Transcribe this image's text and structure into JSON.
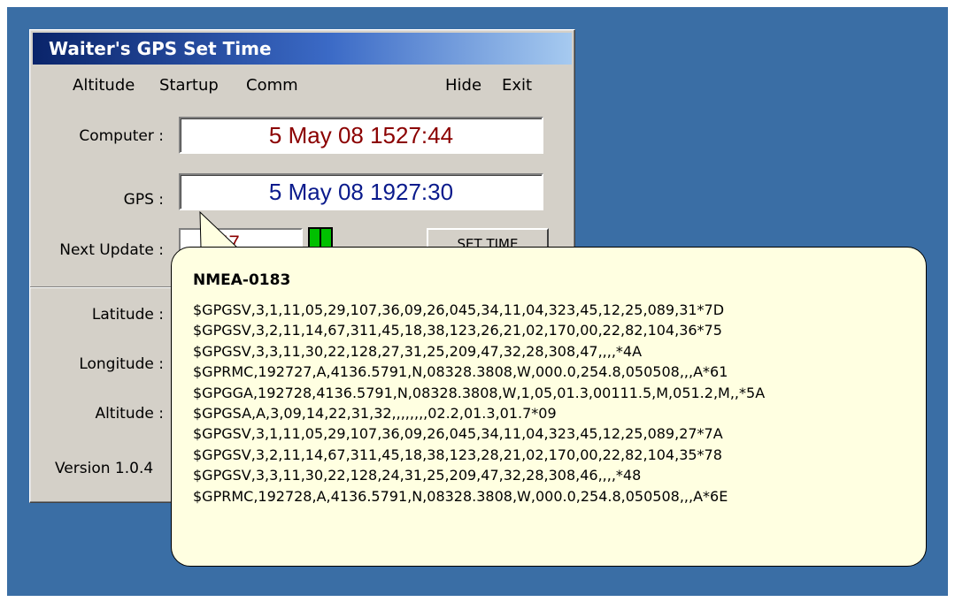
{
  "window": {
    "title": "Waiter's GPS Set Time"
  },
  "menu": {
    "altitude": "Altitude",
    "startup": "Startup",
    "comm": "Comm",
    "hide": "Hide",
    "exit": "Exit"
  },
  "form": {
    "computer_label": "Computer :",
    "computer_time": "5 May 08  1527:44",
    "gps_label": "GPS :",
    "gps_time": "5 May 08  1927:30",
    "next_update_label": "Next Update :",
    "next_update_value": "347",
    "set_time_button": "SET TIME",
    "latitude_label": "Latitude :",
    "longitude_label": "Longitude :",
    "altitude_label": "Altitude :",
    "version_text": "Version 1.0.4"
  },
  "tooltip": {
    "heading": "NMEA-0183",
    "lines": [
      "$GPGSV,3,1,11,05,29,107,36,09,26,045,34,11,04,323,45,12,25,089,31*7D",
      "$GPGSV,3,2,11,14,67,311,45,18,38,123,26,21,02,170,00,22,82,104,36*75",
      "$GPGSV,3,3,11,30,22,128,27,31,25,209,47,32,28,308,47,,,,*4A",
      "$GPRMC,192727,A,4136.5791,N,08328.3808,W,000.0,254.8,050508,,,A*61",
      "$GPGGA,192728,4136.5791,N,08328.3808,W,1,05,01.3,00111.5,M,051.2,M,,*5A",
      "$GPGSA,A,3,09,14,22,31,32,,,,,,,,02.2,01.3,01.7*09",
      "$GPGSV,3,1,11,05,29,107,36,09,26,045,34,11,04,323,45,12,25,089,27*7A",
      "$GPGSV,3,2,11,14,67,311,45,18,38,123,28,21,02,170,00,22,82,104,35*78",
      "$GPGSV,3,3,11,30,22,128,24,31,25,209,47,32,28,308,46,,,,*48",
      "$GPRMC,192728,A,4136.5791,N,08328.3808,W,000.0,254.8,050508,,,A*6E"
    ]
  },
  "colors": {
    "desktop": "#3a6ea5",
    "window_face": "#d4d0c8",
    "computer_time": "#8b0000",
    "gps_time": "#0a1a8c",
    "tooltip_bg": "#ffffe1",
    "status_indicator": "#00c000"
  }
}
